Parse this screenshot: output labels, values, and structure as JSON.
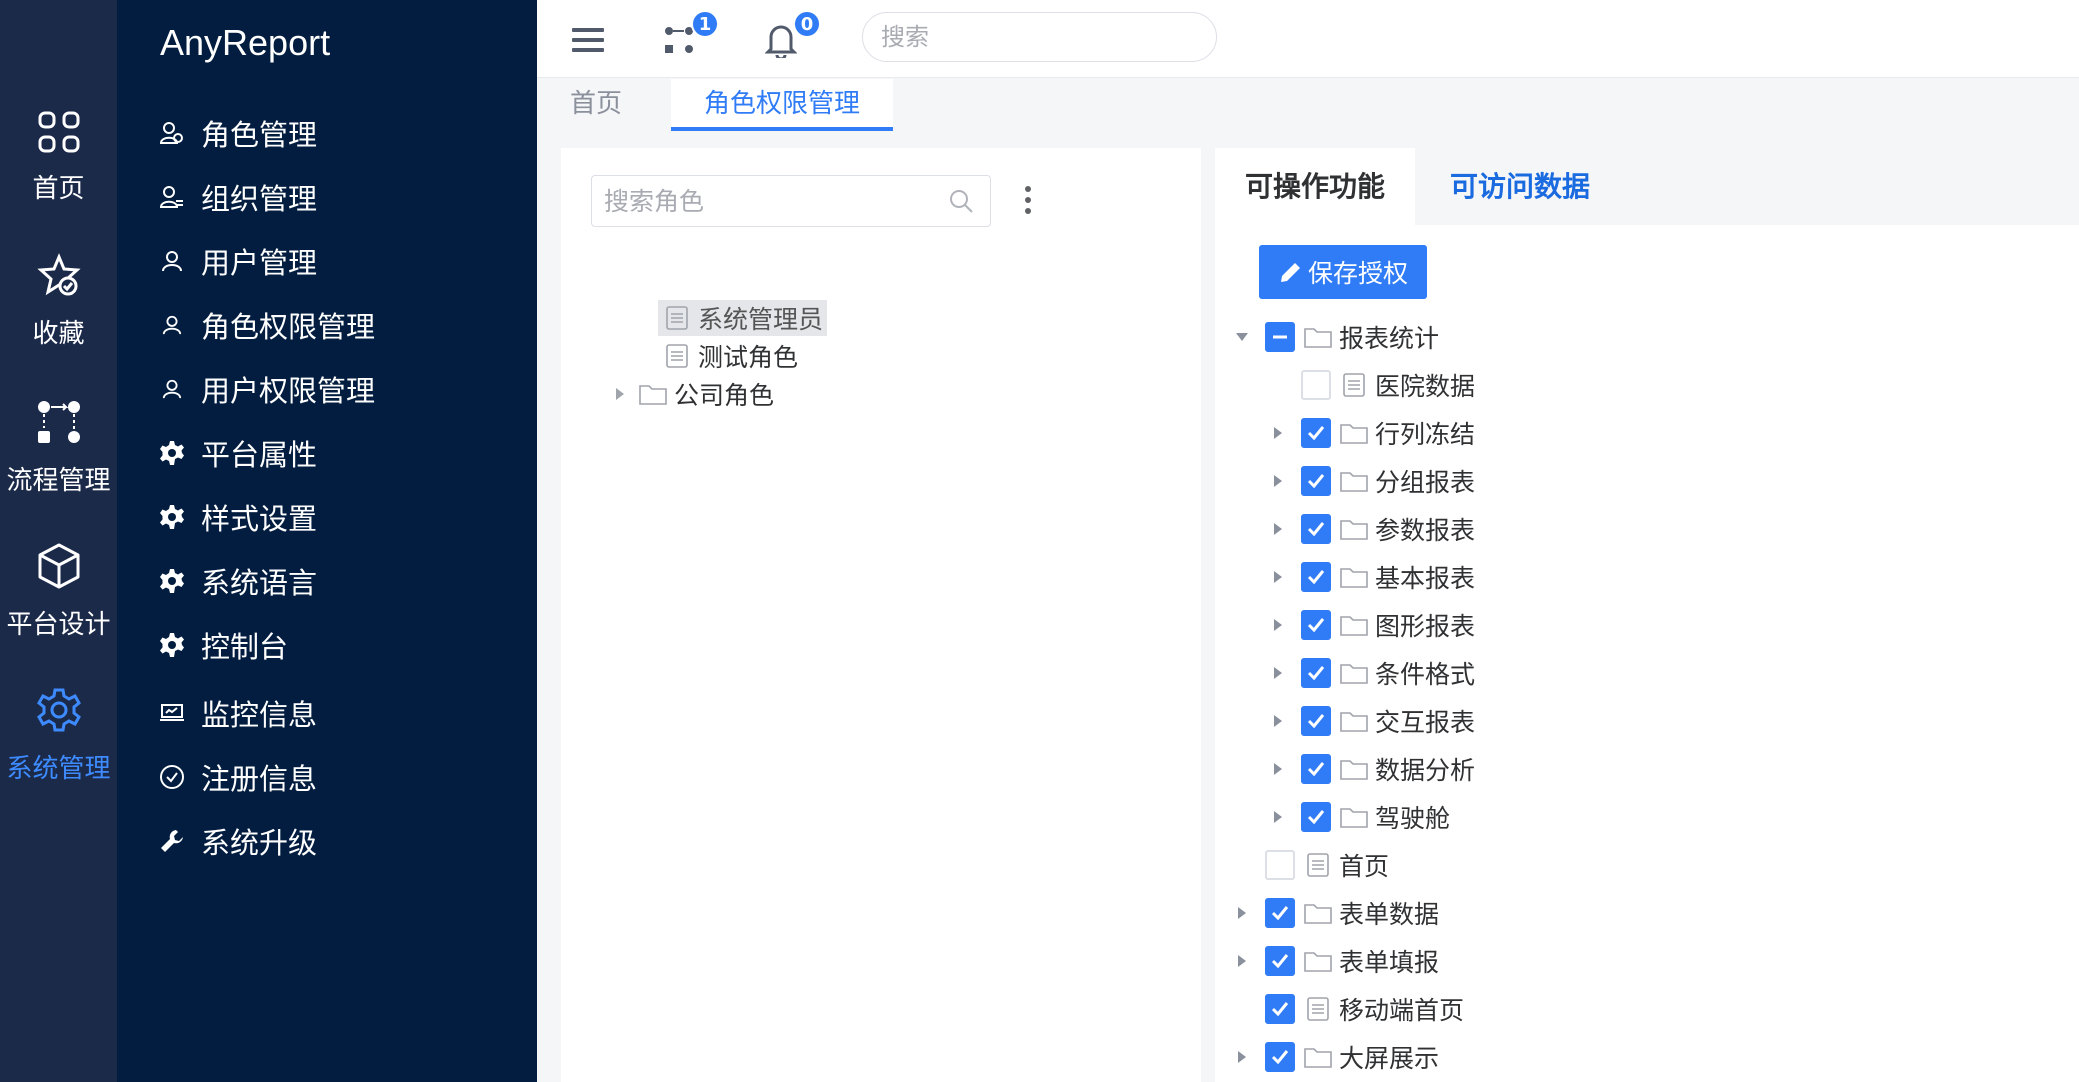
{
  "rail": [
    {
      "label": "首页",
      "icon": "grid-icon"
    },
    {
      "label": "收藏",
      "icon": "star-icon"
    },
    {
      "label": "流程管理",
      "icon": "flow-icon"
    },
    {
      "label": "平台设计",
      "icon": "cube-icon"
    },
    {
      "label": "系统管理",
      "icon": "gear-icon"
    }
  ],
  "brand": "AnyReport",
  "menu": [
    {
      "label": "角色管理",
      "icon": "role-icon"
    },
    {
      "label": "组织管理",
      "icon": "org-icon"
    },
    {
      "label": "用户管理",
      "icon": "user-icon"
    },
    {
      "label": "角色权限管理",
      "icon": "role-perm-icon"
    },
    {
      "label": "用户权限管理",
      "icon": "user-perm-icon"
    },
    {
      "label": "平台属性",
      "icon": "cog-icon"
    },
    {
      "label": "样式设置",
      "icon": "cog-icon"
    },
    {
      "label": "系统语言",
      "icon": "cog-icon"
    },
    {
      "label": "控制台",
      "icon": "cog-icon"
    },
    {
      "label": "监控信息",
      "icon": "monitor-icon"
    },
    {
      "label": "注册信息",
      "icon": "check-circle-icon"
    },
    {
      "label": "系统升级",
      "icon": "wrench-icon"
    }
  ],
  "topbar": {
    "flow_badge": "1",
    "bell_badge": "0",
    "search_placeholder": "搜索"
  },
  "tabs": [
    {
      "label": "首页"
    },
    {
      "label": "角色权限管理"
    }
  ],
  "role_panel": {
    "search_placeholder": "搜索角色",
    "tree": [
      {
        "label": "系统管理员",
        "type": "file",
        "selected": true
      },
      {
        "label": "测试角色",
        "type": "file"
      },
      {
        "label": "公司角色",
        "type": "folder",
        "expandable": true
      }
    ]
  },
  "perm_panel": {
    "tabs": [
      {
        "label": "可操作功能"
      },
      {
        "label": "可访问数据"
      }
    ],
    "save_label": "保存授权",
    "tree": [
      {
        "label": "报表统计",
        "type": "folder",
        "state": "indeterminate",
        "expanded": true,
        "level": 0
      },
      {
        "label": "医院数据",
        "type": "file",
        "state": "off",
        "level": 1
      },
      {
        "label": "行列冻结",
        "type": "folder",
        "state": "on",
        "level": 1
      },
      {
        "label": "分组报表",
        "type": "folder",
        "state": "on",
        "level": 1
      },
      {
        "label": "参数报表",
        "type": "folder",
        "state": "on",
        "level": 1
      },
      {
        "label": "基本报表",
        "type": "folder",
        "state": "on",
        "level": 1
      },
      {
        "label": "图形报表",
        "type": "folder",
        "state": "on",
        "level": 1
      },
      {
        "label": "条件格式",
        "type": "folder",
        "state": "on",
        "level": 1
      },
      {
        "label": "交互报表",
        "type": "folder",
        "state": "on",
        "level": 1
      },
      {
        "label": "数据分析",
        "type": "folder",
        "state": "on",
        "level": 1
      },
      {
        "label": "驾驶舱",
        "type": "folder",
        "state": "on",
        "level": 1
      },
      {
        "label": "首页",
        "type": "file",
        "state": "off",
        "level": 0
      },
      {
        "label": "表单数据",
        "type": "folder",
        "state": "on",
        "level": 0
      },
      {
        "label": "表单填报",
        "type": "folder",
        "state": "on",
        "level": 0
      },
      {
        "label": "移动端首页",
        "type": "file",
        "state": "on",
        "level": 0
      },
      {
        "label": "大屏展示",
        "type": "folder",
        "state": "on",
        "level": 0
      }
    ]
  },
  "colors": {
    "rail_bg": "#1c2a4a",
    "menu_bg": "#021d3f",
    "accent": "#2f7cf6"
  }
}
